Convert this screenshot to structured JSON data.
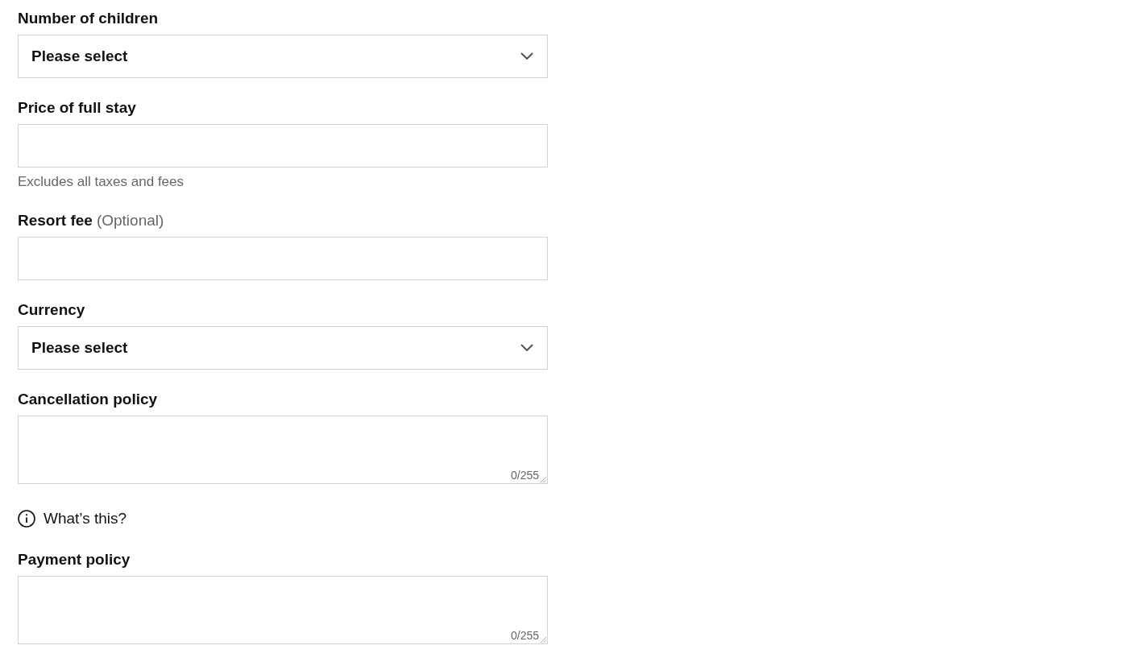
{
  "fields": [
    {
      "kind": "select",
      "label": "Number of children",
      "value": "Please select"
    },
    {
      "kind": "text",
      "label": "Price of full stay",
      "hint": "Excludes all taxes and fees"
    },
    {
      "kind": "text",
      "label": "Resort fee",
      "optional": "(Optional)"
    },
    {
      "kind": "select",
      "label": "Currency",
      "value": "Please select"
    },
    {
      "kind": "textarea",
      "label": "Cancellation policy",
      "counter": "0/255",
      "help_link": "What’s this?"
    },
    {
      "kind": "textarea",
      "label": "Payment policy",
      "counter": "0/255"
    }
  ]
}
